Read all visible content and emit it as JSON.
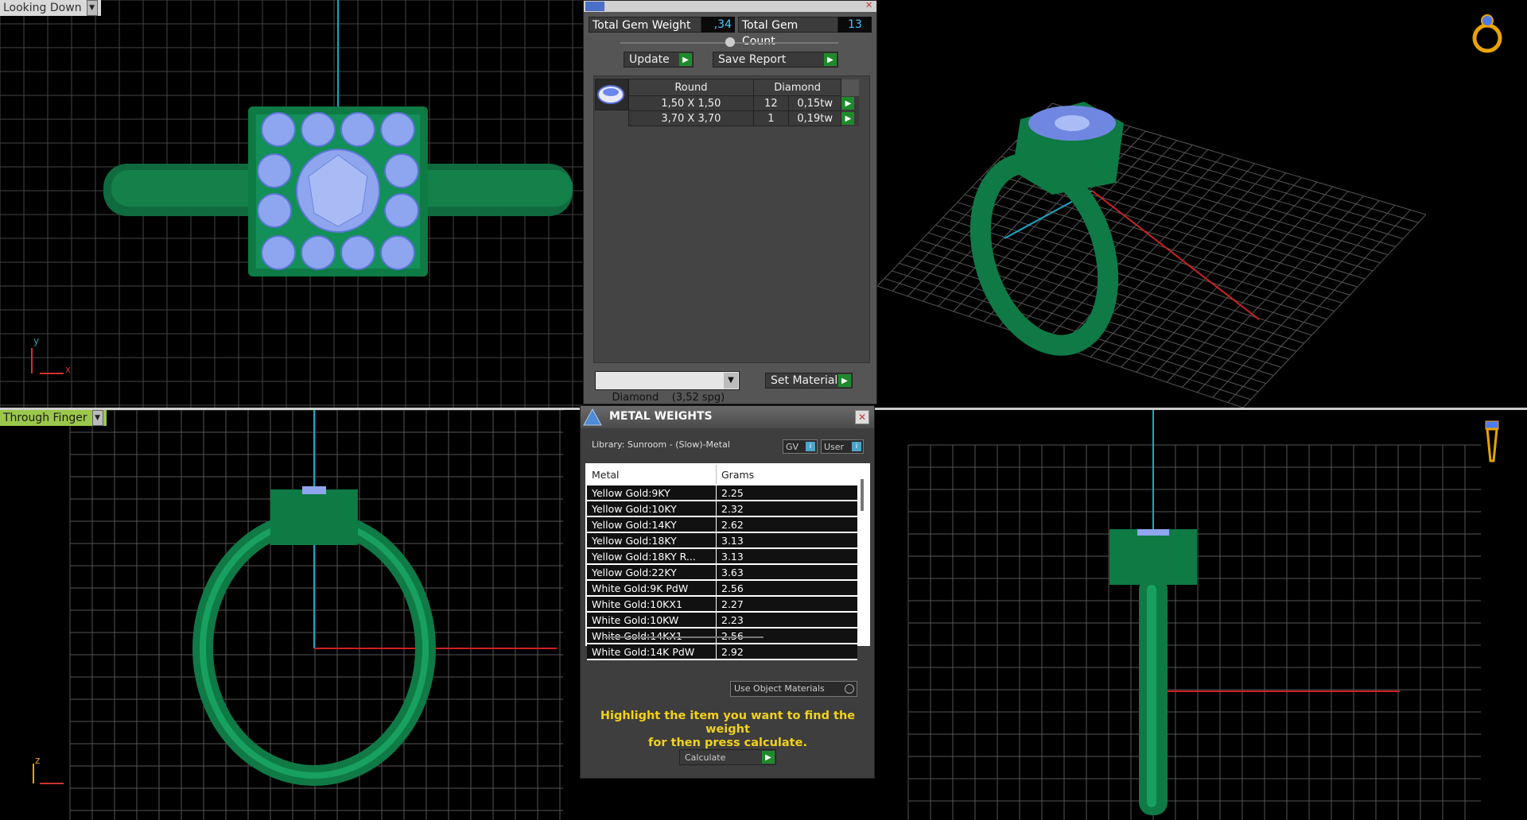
{
  "viewports": {
    "top_left": {
      "label": "Looking Down"
    },
    "bottom_left": {
      "label": "Through Finger"
    },
    "axes": {
      "x": "x",
      "y": "y",
      "z": "z"
    }
  },
  "gem_panel": {
    "total_weight_label": "Total Gem Weight",
    "total_weight_value": ",34",
    "total_count_label": "Total Gem Count",
    "total_count_value": "13",
    "update_label": "Update",
    "save_report_label": "Save Report",
    "headers": [
      "Round",
      "Diamond"
    ],
    "rows": [
      {
        "size": "1,50 X 1,50",
        "count": "12",
        "weight": "0,15tw"
      },
      {
        "size": "3,70 X 3,70",
        "count": "1",
        "weight": "0,19tw"
      }
    ],
    "material_select": "Diamond    (3,52 spg)",
    "set_material_label": "Set Material"
  },
  "metal_panel": {
    "title": "METAL WEIGHTS",
    "library": "Library: Sunroom - (Slow)-Metal",
    "gv_label": "GV",
    "user_label": "User",
    "col_metal": "Metal",
    "col_grams": "Grams",
    "rows": [
      {
        "metal": "Yellow Gold:9KY",
        "grams": "2.25"
      },
      {
        "metal": "Yellow Gold:10KY",
        "grams": "2.32"
      },
      {
        "metal": "Yellow Gold:14KY",
        "grams": "2.62"
      },
      {
        "metal": "Yellow Gold:18KY",
        "grams": "3.13"
      },
      {
        "metal": "Yellow Gold:18KY R...",
        "grams": "3.13"
      },
      {
        "metal": "Yellow Gold:22KY",
        "grams": "3.63"
      },
      {
        "metal": "White Gold:9K PdW",
        "grams": "2.56"
      },
      {
        "metal": "White Gold:10KX1",
        "grams": "2.27"
      },
      {
        "metal": "White Gold:10KW",
        "grams": "2.23"
      },
      {
        "metal": "White Gold:14KX1",
        "grams": "2.56"
      },
      {
        "metal": "White Gold:14K PdW",
        "grams": "2.92"
      }
    ],
    "use_object_materials": "Use Object Materials",
    "hint_line1": "Highlight the item you want to find the weight",
    "hint_line2": "for then press calculate.",
    "calculate_label": "Calculate"
  }
}
